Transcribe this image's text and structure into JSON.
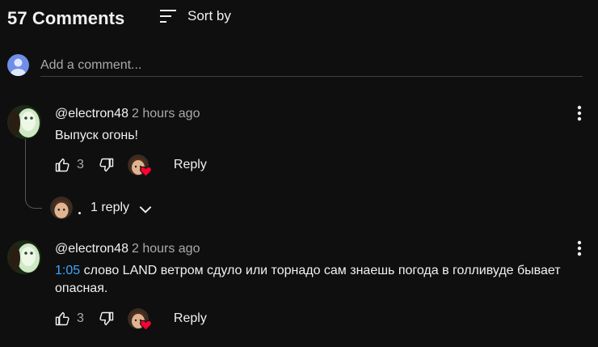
{
  "header": {
    "title": "57 Comments",
    "sort_label": "Sort by"
  },
  "add_comment": {
    "placeholder": "Add a comment..."
  },
  "comments": [
    {
      "author": "@electron48",
      "time": "2 hours ago",
      "text": "Выпуск огонь!",
      "likes": "3",
      "reply_label": "Reply",
      "replies_label": "1 reply"
    },
    {
      "author": "@electron48",
      "time": "2 hours ago",
      "timestamp": "1:05",
      "text_line1": " слово LAND ветром сдуло или торнадо сам знаешь погода в голливуде бывает",
      "text_line2": "опасная.",
      "likes": "3",
      "reply_label": "Reply"
    }
  ],
  "colors": {
    "background": "#0f0f0f",
    "timestamp_link": "#3ea6ff",
    "heart": "#ff0033"
  }
}
